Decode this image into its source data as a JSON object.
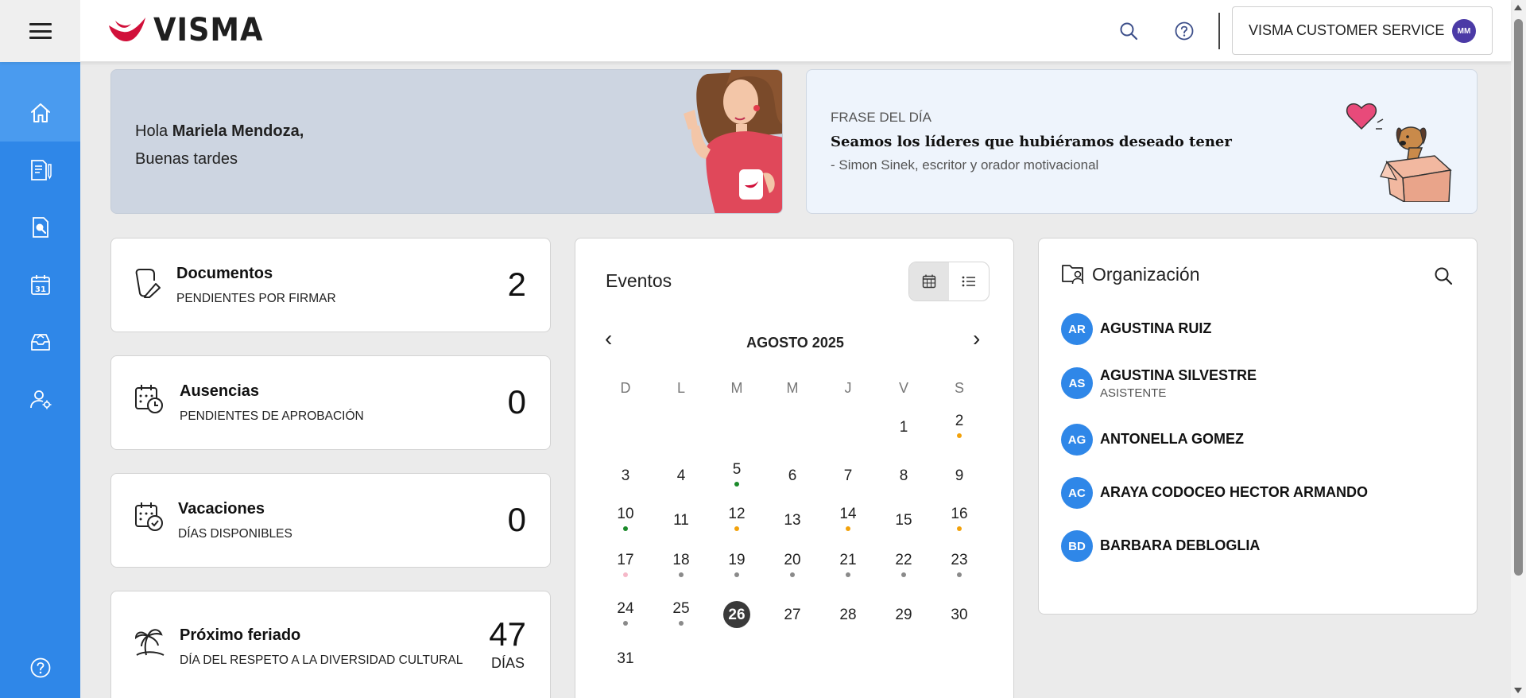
{
  "header": {
    "brand": "VISMA",
    "customer_service_label": "VISMA CUSTOMER SERVICE",
    "user_initials": "MM",
    "brand_color": "#d1103a",
    "icons": [
      "menu-icon",
      "search-icon",
      "help-icon"
    ]
  },
  "sidebar": {
    "accent": "#2f87e8",
    "items": [
      {
        "icon": "home-icon"
      },
      {
        "icon": "documents-sign-icon"
      },
      {
        "icon": "document-search-icon"
      },
      {
        "icon": "calendar-icon",
        "label": "31"
      },
      {
        "icon": "inbox-icon"
      },
      {
        "icon": "user-settings-icon"
      },
      {
        "icon": "help-icon"
      }
    ]
  },
  "greeting": {
    "hello": "Hola",
    "name": "Mariela Mendoza,",
    "salutation": "Buenas tardes"
  },
  "quote": {
    "label": "FRASE DEL DÍA",
    "text": "Seamos los líderes que hubiéramos deseado tener",
    "author": "- Simon Sinek, escritor y orador motivacional"
  },
  "stats": {
    "documents": {
      "title": "Documentos",
      "subtitle": "PENDIENTES POR FIRMAR",
      "value": "2"
    },
    "absences": {
      "title": "Ausencias",
      "subtitle": "PENDIENTES DE APROBACIÓN",
      "value": "0"
    },
    "vacations": {
      "title": "Vacaciones",
      "subtitle": "DÍAS DISPONIBLES",
      "value": "0"
    },
    "holiday": {
      "title": "Próximo feriado",
      "subtitle": "DÍA DEL RESPETO A LA DIVERSIDAD CULTURAL",
      "value": "47",
      "unit": "DÍAS"
    }
  },
  "events": {
    "title": "Eventos",
    "month": "AGOSTO 2025",
    "prev": "‹",
    "next": "›",
    "weekdays": [
      "D",
      "L",
      "M",
      "M",
      "J",
      "V",
      "S"
    ],
    "today": "26",
    "dot_colors": {
      "green": "#1b8a2a",
      "orange": "#f2a20c",
      "gray": "#8a8a8a",
      "pink": "#f5b8c8"
    },
    "days": [
      [
        "",
        "",
        "",
        "",
        "",
        "1",
        "2"
      ],
      [
        "3",
        "4",
        "5",
        "6",
        "7",
        "8",
        "9"
      ],
      [
        "10",
        "11",
        "12",
        "13",
        "14",
        "15",
        "16"
      ],
      [
        "17",
        "18",
        "19",
        "20",
        "21",
        "22",
        "23"
      ],
      [
        "24",
        "25",
        "26",
        "27",
        "28",
        "29",
        "30"
      ],
      [
        "31",
        "",
        "",
        "",
        "",
        "",
        ""
      ]
    ],
    "dots": {
      "2": "orange",
      "5": "green",
      "10": "green",
      "12": "orange",
      "14": "orange",
      "16": "orange",
      "17": "pink",
      "18": "gray",
      "19": "gray",
      "20": "gray",
      "21": "gray",
      "22": "gray",
      "23": "gray",
      "24": "gray",
      "25": "gray"
    }
  },
  "organization": {
    "title": "Organización",
    "people": [
      {
        "initials": "AR",
        "name": "AGUSTINA RUIZ",
        "role": ""
      },
      {
        "initials": "AS",
        "name": "AGUSTINA SILVESTRE",
        "role": "ASISTENTE"
      },
      {
        "initials": "AG",
        "name": "ANTONELLA GOMEZ",
        "role": ""
      },
      {
        "initials": "AC",
        "name": "ARAYA CODOCEO HECTOR ARMANDO",
        "role": ""
      },
      {
        "initials": "BD",
        "name": "BARBARA DEBLOGLIA",
        "role": ""
      }
    ]
  }
}
